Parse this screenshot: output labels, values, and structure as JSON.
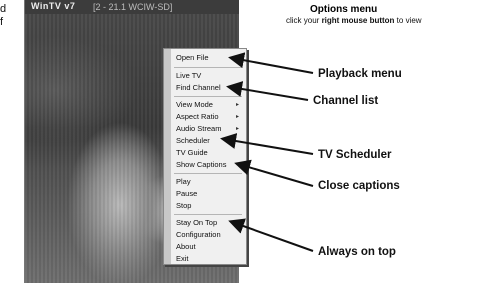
{
  "page_left": {
    "line1": "d",
    "line2": "f"
  },
  "player": {
    "logo": "WinTV v7",
    "channel": "[2 - 21.1   WCIW-SD]"
  },
  "menu": {
    "items": [
      {
        "label": "Open File"
      },
      {
        "label": "Live TV"
      },
      {
        "label": "Find Channel"
      },
      {
        "label": "View Mode",
        "submenu": true
      },
      {
        "label": "Aspect Ratio",
        "submenu": true
      },
      {
        "label": "Audio Stream",
        "submenu": true
      },
      {
        "label": "Scheduler"
      },
      {
        "label": "TV Guide"
      },
      {
        "label": "Show Captions"
      },
      {
        "label": "Play"
      },
      {
        "label": "Pause"
      },
      {
        "label": "Stop"
      },
      {
        "label": "Stay On Top"
      },
      {
        "label": "Configuration"
      },
      {
        "label": "About"
      },
      {
        "label": "Exit"
      }
    ],
    "submenu_glyph": "▸"
  },
  "options_header": {
    "title": "Options menu",
    "subtitle_prefix": "click your ",
    "subtitle_bold": "right mouse button",
    "subtitle_suffix": " to view"
  },
  "callouts": {
    "playback": "Playback menu",
    "channel": "Channel list",
    "scheduler": "TV Scheduler",
    "captions": "Close captions",
    "ontop": "Always on top"
  }
}
